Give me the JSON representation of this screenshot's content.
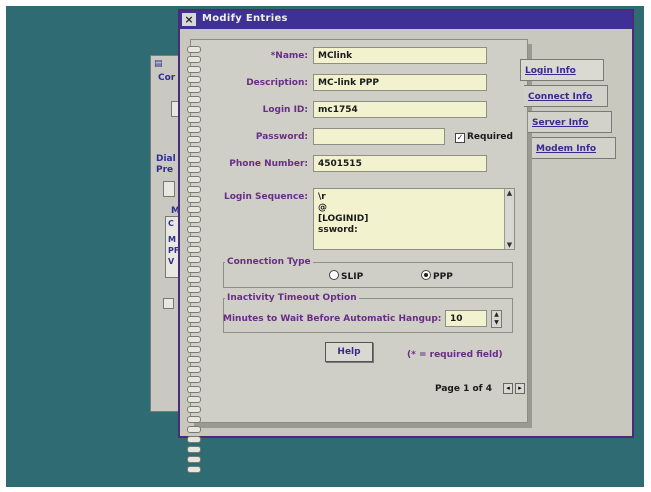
{
  "dialog": {
    "title": "Modify Entries",
    "close_glyph": "×"
  },
  "background_window": {
    "fragments": [
      "Cor",
      "Dial",
      "Pre",
      "M",
      "C",
      "M",
      "PF",
      "V"
    ]
  },
  "form": {
    "name_label": "*Name:",
    "name_value": "MClink",
    "description_label": "Description:",
    "description_value": "MC-link PPP",
    "login_id_label": "Login ID:",
    "login_id_value": "mc1754",
    "password_label": "Password:",
    "password_value": "",
    "required_label": "Required",
    "required_checked": true,
    "phone_label": "Phone Number:",
    "phone_value": "4501515",
    "login_sequence_label": "Login Sequence:",
    "login_sequence_lines": [
      "\\r",
      "@",
      "[LOGINID]",
      "ssword:"
    ]
  },
  "connection": {
    "title": "Connection Type",
    "options": [
      "SLIP",
      "PPP"
    ],
    "selected": "PPP"
  },
  "timeout": {
    "title": "Inactivity Timeout Option",
    "label": "Minutes to Wait Before Automatic Hangup:",
    "value": "10"
  },
  "help_label": "Help",
  "required_note": "(* = required field)",
  "pager": {
    "text": "Page 1 of 4"
  },
  "tabs": [
    "Login Info",
    "Connect Info",
    "Server Info",
    "Modem Info"
  ],
  "colors": {
    "desktop": "#2f6b72",
    "titlebar": "#3f3096",
    "label": "#6a2d85",
    "field": "#f3f2cf"
  }
}
